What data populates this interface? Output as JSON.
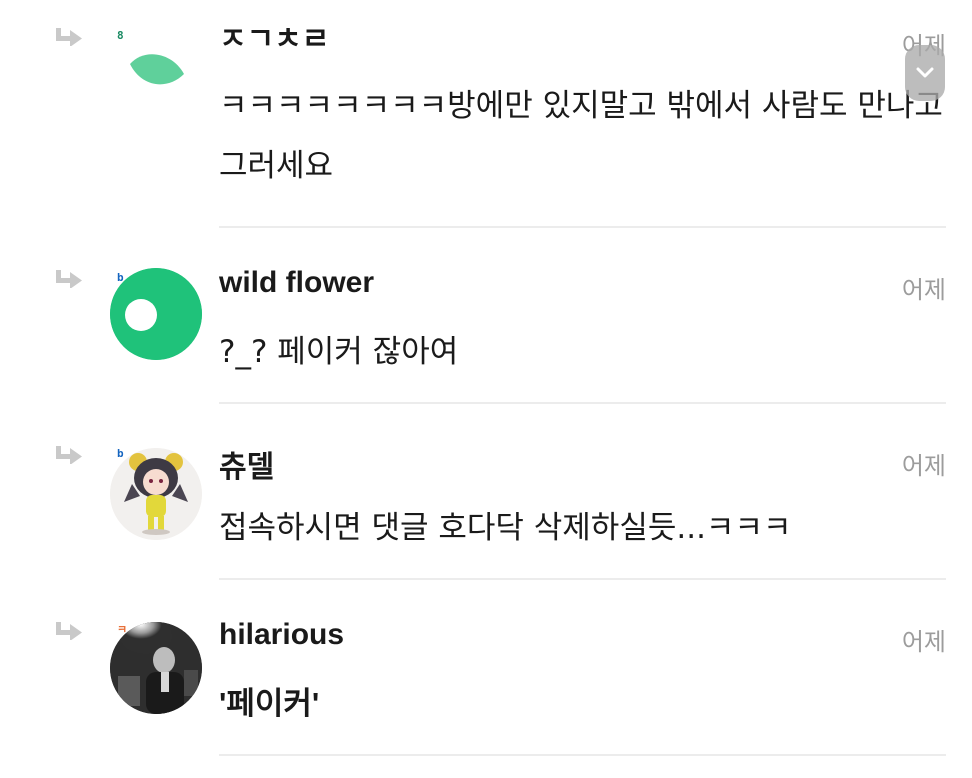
{
  "comments": [
    {
      "author": "ㅈㄱㅊㄹ",
      "level_badge": "8",
      "level_color": "#1a8a63",
      "time": "어제",
      "text": "ㅋㅋㅋㅋㅋㅋㅋㅋ방에만 있지말고 밖에서 사람도 만나고 그러세요",
      "avatar": "leaf-avatar"
    },
    {
      "author": "wild flower",
      "level_badge": "b",
      "level_color": "#1565c0",
      "time": "어제",
      "text": "?_? 페이커 잖아여",
      "avatar": "green-ring-avatar"
    },
    {
      "author": "츄델",
      "level_badge": "b",
      "level_color": "#1565c0",
      "time": "어제",
      "text": "접속하시면 댓글 호다닥 삭제하실듯...ㅋㅋㅋ",
      "avatar": "character-avatar"
    },
    {
      "author": "hilarious",
      "level_badge": "ㅋ",
      "level_color": "#e8703a",
      "time": "어제",
      "text": "'페이커'",
      "avatar": "photo-avatar"
    }
  ],
  "colors": {
    "leaf": "#5fd09b",
    "ring": "#1fc27a",
    "divider": "#ececec",
    "time": "#9c9c9c"
  },
  "icons": {
    "reply": "reply-arrow-icon",
    "scroll": "chevron-down-icon"
  }
}
